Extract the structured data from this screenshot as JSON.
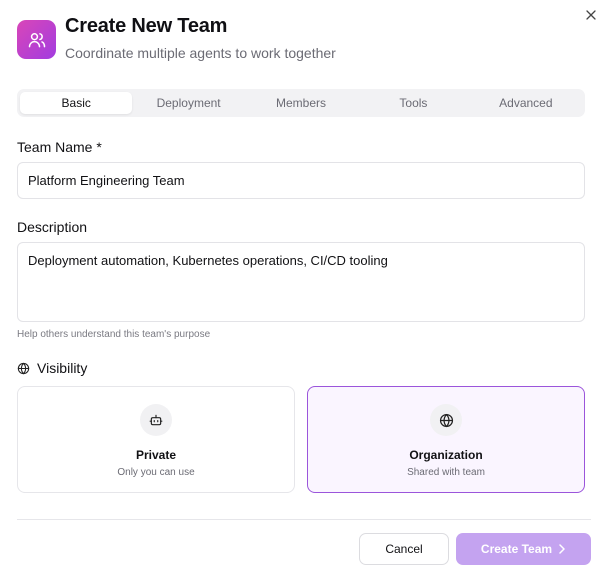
{
  "dialog": {
    "title": "Create New Team",
    "subtitle": "Coordinate multiple agents to work together",
    "header_icon": "users-icon",
    "close_icon": "close-icon"
  },
  "tabs": [
    {
      "label": "Basic",
      "active": true
    },
    {
      "label": "Deployment",
      "active": false
    },
    {
      "label": "Members",
      "active": false
    },
    {
      "label": "Tools",
      "active": false
    },
    {
      "label": "Advanced",
      "active": false
    }
  ],
  "form": {
    "team_name": {
      "label": "Team Name *",
      "value": "Platform Engineering Team"
    },
    "description": {
      "label": "Description",
      "value": "Deployment automation, Kubernetes operations, CI/CD tooling",
      "help": "Help others understand this team's purpose"
    },
    "visibility": {
      "label": "Visibility",
      "icon": "globe-icon",
      "options": [
        {
          "title": "Private",
          "description": "Only you can use",
          "icon": "bot-icon",
          "selected": false
        },
        {
          "title": "Organization",
          "description": "Shared with team",
          "icon": "globe-icon",
          "selected": true
        }
      ]
    }
  },
  "footer": {
    "cancel_label": "Cancel",
    "create_label": "Create Team",
    "create_icon": "chevron-right-icon"
  },
  "colors": {
    "accent_gradient_start": "#d946b8",
    "accent_gradient_end": "#a23ce0",
    "selected_border": "#9b55db",
    "selected_bg": "#faf5ff",
    "create_button_bg": "#c4a3f0"
  }
}
